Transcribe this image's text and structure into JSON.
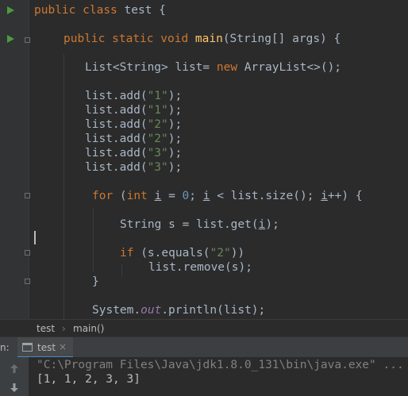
{
  "editor": {
    "line1": {
      "kw1": "public",
      "kw2": "class",
      "name": "test",
      "brace": "{"
    },
    "line2": {
      "kw1": "public",
      "kw2": "static",
      "kw3": "void",
      "fn": "main",
      "rest": "(String[] args) {"
    },
    "line3": {
      "a": "List<String> list= ",
      "kw": "new",
      "b": " ArrayList<>();"
    },
    "adds": [
      {
        "prefix": "list.add(",
        "arg": "\"1\"",
        "suffix": ");"
      },
      {
        "prefix": "list.add(",
        "arg": "\"1\"",
        "suffix": ");"
      },
      {
        "prefix": "list.add(",
        "arg": "\"2\"",
        "suffix": ");"
      },
      {
        "prefix": "list.add(",
        "arg": "\"2\"",
        "suffix": ");"
      },
      {
        "prefix": "list.add(",
        "arg": "\"3\"",
        "suffix": ");"
      },
      {
        "prefix": "list.add(",
        "arg": "\"3\"",
        "suffix": ");"
      }
    ],
    "for_line": {
      "kw_for": "for",
      "p1": " (",
      "kw_int": "int",
      "sp": " ",
      "i": "i",
      "eq": " = ",
      "zero": "0",
      "semi": "; ",
      "i2": "i",
      "cond": " < list.size(); ",
      "i3": "i",
      "inc": "++) {"
    },
    "get_line": {
      "a": "String s = list.get(",
      "i": "i",
      "b": ");"
    },
    "if_line": {
      "kw": "if",
      "a": " (s.equals(",
      "str": "\"2\"",
      "b": "))"
    },
    "remove_line": "list.remove(s);",
    "close_brace": "}",
    "print_line": {
      "a": "System.",
      "field": "out",
      "b": ".println(list);"
    }
  },
  "breadcrumb": {
    "class": "test",
    "sep": "›",
    "method": "main()"
  },
  "run_panel": {
    "label": "n:",
    "tab": "test",
    "close": "×"
  },
  "console": {
    "command": "\"C:\\Program Files\\Java\\jdk1.8.0_131\\bin\\java.exe\" ...",
    "output": "[1, 1, 2, 3, 3]"
  },
  "colors": {
    "background": "#2b2b2b",
    "keyword": "#cc7832",
    "string": "#6a8759",
    "number": "#6897bb",
    "method": "#ffc66d",
    "field": "#9876aa"
  }
}
